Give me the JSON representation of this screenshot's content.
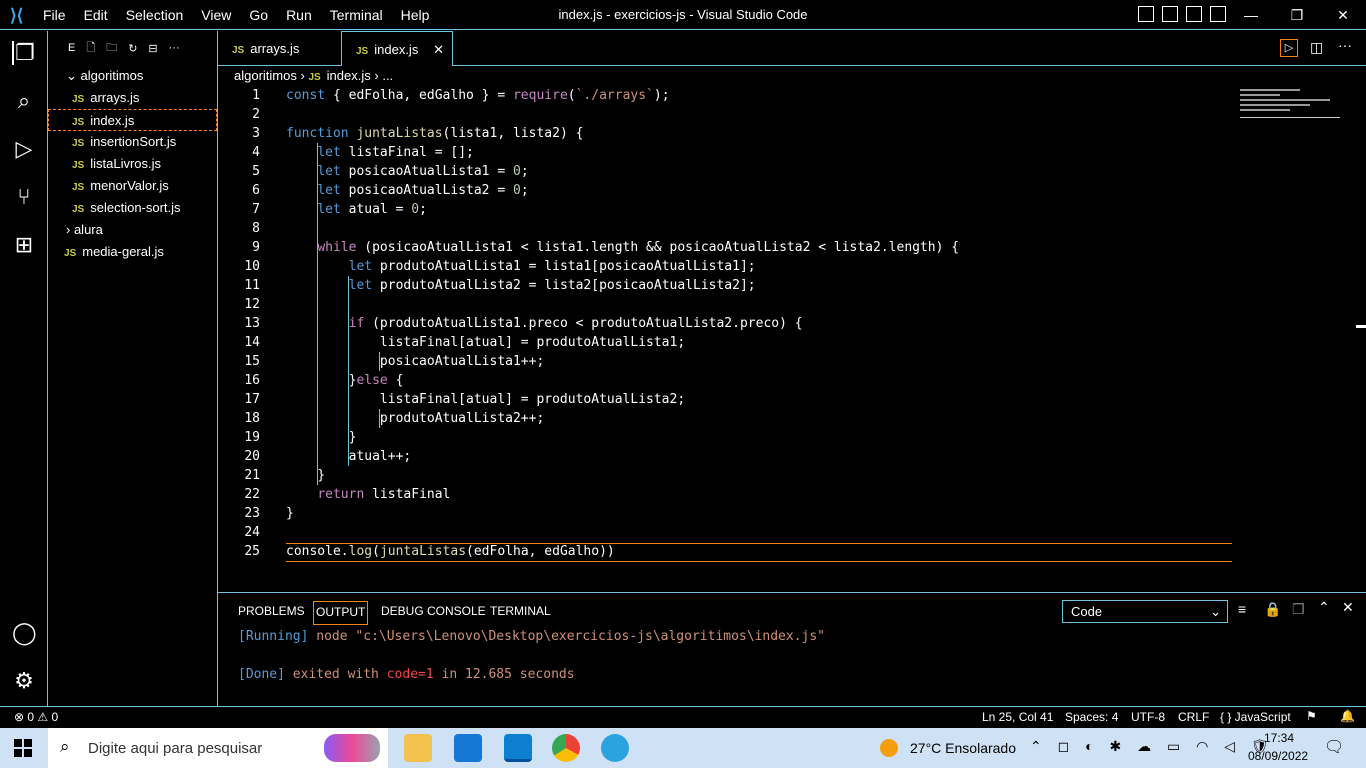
{
  "window": {
    "title": "index.js - exercicios-js - Visual Studio Code"
  },
  "menu": [
    "File",
    "Edit",
    "Selection",
    "View",
    "Go",
    "Run",
    "Terminal",
    "Help"
  ],
  "sidebar": {
    "header": "E",
    "folder": "algoritimos",
    "files": [
      "arrays.js",
      "index.js",
      "insertionSort.js",
      "listaLivros.js",
      "menorValor.js",
      "selection-sort.js"
    ],
    "folder2": "alura",
    "rootfile": "media-geral.js"
  },
  "tabs": [
    {
      "label": "arrays.js"
    },
    {
      "label": "index.js"
    }
  ],
  "breadcrumb": {
    "folder": "algoritimos",
    "file": "index.js",
    "more": "..."
  },
  "code": {
    "lines": [
      "const { edFolha, edGalho } = require(`./arrays`);",
      "",
      "function juntaListas(lista1, lista2) {",
      "    let listaFinal = [];",
      "    let posicaoAtualLista1 = 0;",
      "    let posicaoAtualLista2 = 0;",
      "    let atual = 0;",
      "",
      "    while (posicaoAtualLista1 < lista1.length && posicaoAtualLista2 < lista2.length) {",
      "        let produtoAtualLista1 = lista1[posicaoAtualLista1];",
      "        let produtoAtualLista2 = lista2[posicaoAtualLista2];",
      "",
      "        if (produtoAtualLista1.preco < produtoAtualLista2.preco) {",
      "            listaFinal[atual] = produtoAtualLista1;",
      "            posicaoAtualLista1++;",
      "        }else {",
      "            listaFinal[atual] = produtoAtualLista2;",
      "            produtoAtualLista2++;",
      "        }",
      "        atual++;",
      "    }",
      "    return listaFinal",
      "}",
      "",
      "console.log(juntaListas(edFolha, edGalho))"
    ]
  },
  "panel": {
    "tabs": [
      "PROBLEMS",
      "OUTPUT",
      "DEBUG CONSOLE",
      "TERMINAL"
    ],
    "selector": "Code",
    "out1_tag": "[Running]",
    "out1": " node \"c:\\Users\\Lenovo\\Desktop\\exercicios-js\\algoritimos\\index.js\"",
    "out2_tag": "[Done]",
    "out2a": " exited with ",
    "out2b": "code=1",
    "out2c": " in 12.685 seconds"
  },
  "status": {
    "problems": "⊗ 0 ⚠ 0",
    "position": "Ln 25, Col 41",
    "spaces": "Spaces: 4",
    "encoding": "UTF-8",
    "eol": "CRLF",
    "language": "{ } JavaScript"
  },
  "taskbar": {
    "search": "Digite aqui para pesquisar",
    "weather": "27°C  Ensolarado",
    "time": "17:34",
    "date": "08/09/2022"
  }
}
